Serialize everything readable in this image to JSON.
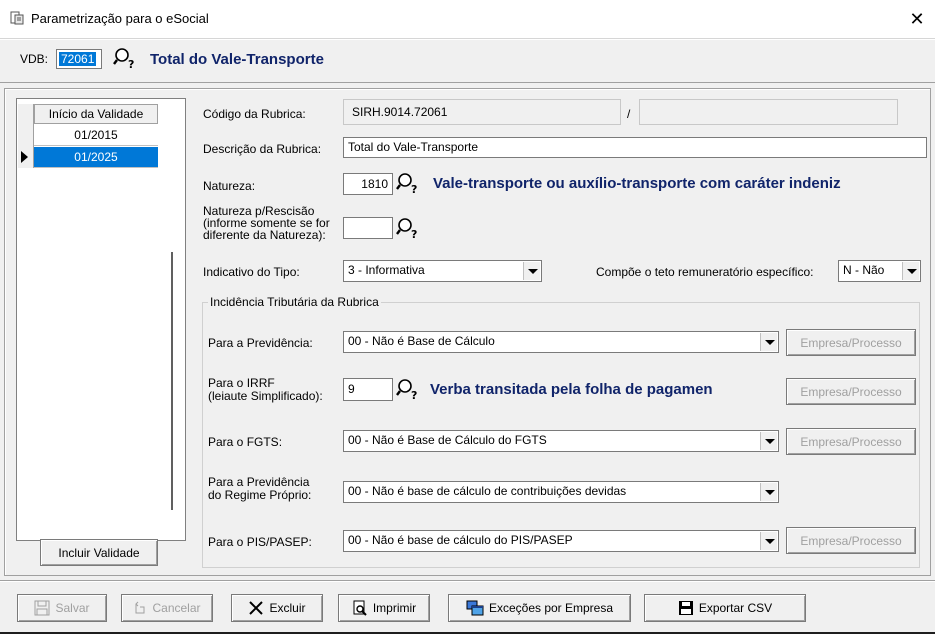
{
  "window": {
    "title": "Parametrização para o eSocial",
    "close_glyph": "✕"
  },
  "header": {
    "vdb_label": "VDB:",
    "vdb_value": "72061",
    "vdb_description": "Total do Vale-Transporte"
  },
  "validity_list": {
    "header": "Início da Validade",
    "rows": [
      "01/2015",
      "01/2025"
    ],
    "selected_index": 1,
    "add_button": "Incluir Validade"
  },
  "form": {
    "codigo_label": "Código da Rubrica:",
    "codigo_value": "SIRH.9014.72061",
    "codigo_separator": "/",
    "codigo_value2": "",
    "descricao_label": "Descrição da Rubrica:",
    "descricao_value": "Total do Vale-Transporte",
    "natureza_label": "Natureza:",
    "natureza_value": "1810",
    "natureza_desc": "Vale-transporte ou auxílio-transporte com caráter indeniz",
    "natureza_resc_label_1": "Natureza p/Rescisão",
    "natureza_resc_label_2": "(informe somente se for",
    "natureza_resc_label_3": "diferente da Natureza):",
    "natureza_resc_value": "",
    "indicativo_label": "Indicativo do Tipo:",
    "indicativo_value": "3 - Informativa",
    "teto_label": "Compõe o teto remuneratório específico:",
    "teto_value": "N - Não"
  },
  "incidencia": {
    "group_title": "Incidência Tributária da Rubrica",
    "previdencia_label": "Para a Previdência:",
    "previdencia_value": "00 - Não é Base de Cálculo",
    "irrf_label_1": "Para o IRRF",
    "irrf_label_2": "(leiaute Simplificado):",
    "irrf_value": "9",
    "irrf_desc": "Verba transitada pela folha de pagamen",
    "fgts_label": "Para o FGTS:",
    "fgts_value": "00 - Não é Base de Cálculo do FGTS",
    "rpps_label_1": "Para a Previdência",
    "rpps_label_2": "do Regime Próprio:",
    "rpps_value": "00 - Não é base de cálculo de contribuições devidas",
    "pis_label": "Para o PIS/PASEP:",
    "pis_value": "00 - Não é base de cálculo do PIS/PASEP",
    "empresa_button": "Empresa/Processo"
  },
  "footer": {
    "salvar": "Salvar",
    "cancelar": "Cancelar",
    "excluir": "Excluir",
    "imprimir": "Imprimir",
    "excecoes": "Exceções por Empresa",
    "exportar": "Exportar CSV"
  }
}
